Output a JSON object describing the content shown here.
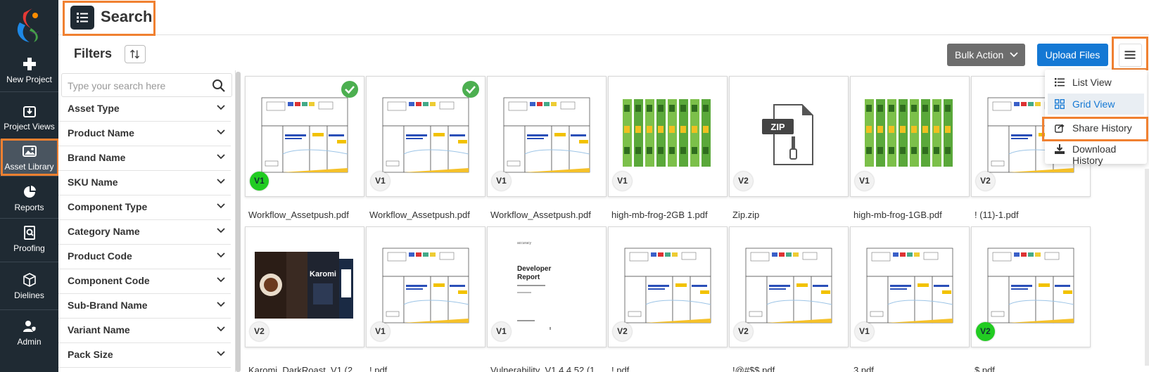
{
  "header": {
    "title": "Search"
  },
  "sidebar": {
    "items": [
      {
        "label": "New Project",
        "icon": "plus-icon"
      },
      {
        "label": "Project Views",
        "icon": "download-box-icon"
      },
      {
        "label": "Asset Library",
        "icon": "image-icon"
      },
      {
        "label": "Reports",
        "icon": "pie-chart-icon"
      },
      {
        "label": "Proofing",
        "icon": "proof-search-icon"
      },
      {
        "label": "Dielines",
        "icon": "cube-icon"
      },
      {
        "label": "Admin",
        "icon": "admin-user-icon"
      }
    ]
  },
  "toolbar": {
    "filters_label": "Filters",
    "bulk_action_label": "Bulk Action",
    "upload_label": "Upload Files"
  },
  "filters": {
    "search_placeholder": "Type your search here",
    "items": [
      "Asset Type",
      "Product Name",
      "Brand Name",
      "SKU Name",
      "Component Type",
      "Category Name",
      "Product Code",
      "Component Code",
      "Sub-Brand Name",
      "Variant Name",
      "Pack Size"
    ]
  },
  "grid": {
    "row1": [
      {
        "name": "Workflow_Assetpush.pdf",
        "version": "V1",
        "version_green": true,
        "checked": true,
        "thumb": "box-dieline"
      },
      {
        "name": "Workflow_Assetpush.pdf",
        "version": "V1",
        "version_green": false,
        "checked": true,
        "thumb": "box-dieline"
      },
      {
        "name": "Workflow_Assetpush.pdf",
        "version": "V1",
        "version_green": false,
        "checked": false,
        "thumb": "box-dieline"
      },
      {
        "name": "high-mb-frog-2GB 1.pdf",
        "version": "V1",
        "version_green": false,
        "checked": false,
        "thumb": "frog"
      },
      {
        "name": "Zip.zip",
        "version": "V2",
        "version_green": false,
        "checked": false,
        "thumb": "zip"
      },
      {
        "name": "high-mb-frog-1GB.pdf",
        "version": "V1",
        "version_green": false,
        "checked": false,
        "thumb": "frog"
      },
      {
        "name": "! (11)-1.pdf",
        "version": "V2",
        "version_green": false,
        "checked": false,
        "thumb": "box-dieline"
      }
    ],
    "row2": [
      {
        "name": "Karomi_DarkRoast_V1 (2",
        "version": "V2",
        "version_green": false,
        "thumb": "coffee"
      },
      {
        "name": "!.pdf",
        "version": "V1",
        "version_green": false,
        "thumb": "box-dieline"
      },
      {
        "name": "Vulnerability_V1.4.4.52 (1",
        "version": "V1",
        "version_green": false,
        "thumb": "report"
      },
      {
        "name": "!.pdf",
        "version": "V2",
        "version_green": false,
        "thumb": "box-dieline"
      },
      {
        "name": "!@#$$.pdf",
        "version": "V2",
        "version_green": false,
        "thumb": "box-dieline"
      },
      {
        "name": "3.pdf",
        "version": "V1",
        "version_green": false,
        "thumb": "box-dieline"
      },
      {
        "name": "$.pdf",
        "version": "V2",
        "version_green": true,
        "thumb": "box-dieline"
      }
    ],
    "zip_badge": "ZIP",
    "report_title_line1": "Developer",
    "report_title_line2": "Report",
    "report_brand": "accuracy",
    "coffee_brand": "Karomi"
  },
  "view_menu": {
    "items": [
      {
        "label": "List View",
        "icon": "list-icon",
        "selected": false
      },
      {
        "label": "Grid View",
        "icon": "grid-icon",
        "selected": true
      },
      {
        "label": "Share History",
        "icon": "share-icon",
        "selected": false
      },
      {
        "label": "Download History",
        "icon": "download-icon",
        "selected": false
      }
    ]
  },
  "colors": {
    "sidebar_bg": "#1f2a33",
    "primary": "#1478d4",
    "highlight": "#f08030",
    "check_green": "#4caf50"
  }
}
